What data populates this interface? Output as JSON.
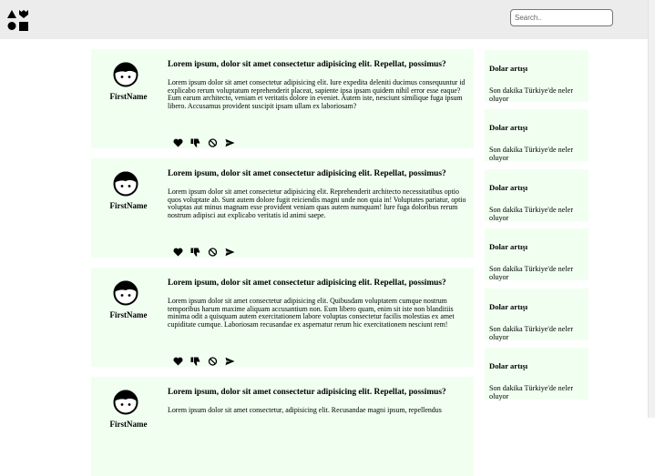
{
  "header": {
    "logo_icon": "shapes-logo-icon",
    "search": {
      "placeholder": "Search..",
      "value": ""
    }
  },
  "posts": [
    {
      "author": "FirstName",
      "avatar_icon": "person-avatar-icon",
      "title": "Lorem ipsum, dolor sit amet consectetur adipisicing elit. Repellat, possimus?",
      "body": "Lorem ipsum dolor sit amet consectetur adipisicing elit. Iure expedita deleniti ducimus consequuntur id explicabo rerum voluptatum reprehenderit placeat, sapiente ipsa ipsam quidem nihil error esse eaque? Eum earum architecto, veniam et veritatis dolore in eveniet. Autem iste, nesciunt similique fuga ipsum libero. Accusamus provident suscipit ipsam ullam ex laboriosam?"
    },
    {
      "author": "FirstName",
      "avatar_icon": "person-avatar-icon",
      "title": "Lorem ipsum, dolor sit amet consectetur adipisicing elit. Repellat, possimus?",
      "body": "Lorem ipsum dolor sit amet consectetur adipisicing elit. Reprehenderit architecto necessitatibus optio quos voluptate ab. Sunt autem dolore fugit reiciendis magni unde non quia in! Voluptates pariatur, optio voluptas aut minus magnam esse provident veniam quas autem numquam! Iure fuga doloribus rerum nostrum adipisci aut explicabo veritatis id animi saepe."
    },
    {
      "author": "FirstName",
      "avatar_icon": "person-avatar-icon",
      "title": "Lorem ipsum, dolor sit amet consectetur adipisicing elit. Repellat, possimus?",
      "body": "Lorem ipsum dolor sit amet consectetur adipisicing elit. Quibusdam voluptatem cumque nostrum temporibus harum maxime aliquam accusantium non. Eum libero quam, enim sit iste non blanditiis minima odit a quisquam autem exercitationem labore voluptas consectetur facilis molestias ex amet cupiditate cumque. Laboriosam recusandae ex aspernatur rerum hic exercitationem nesciunt rem!"
    },
    {
      "author": "FirstName",
      "avatar_icon": "person-avatar-icon",
      "title": "Lorem ipsum, dolor sit amet consectetur adipisicing elit. Repellat, possimus?",
      "body": "Lorem ipsum dolor sit amet consectetur, adipisicing elit. Recusandae magni ipsum, repellendus"
    }
  ],
  "post_actions": [
    {
      "icon": "heart-icon"
    },
    {
      "icon": "thumbs-down-icon"
    },
    {
      "icon": "block-icon"
    },
    {
      "icon": "send-icon"
    }
  ],
  "sidebar": {
    "cards": [
      {
        "title": "Dolar artışı",
        "text": "Son dakika Türkiye'de neler oluyor"
      },
      {
        "title": "Dolar artışı",
        "text": "Son dakika Türkiye'de neler oluyor"
      },
      {
        "title": "Dolar artışı",
        "text": "Son dakika Türkiye'de neler oluyor"
      },
      {
        "title": "Dolar artışı",
        "text": "Son dakika Türkiye'de neler oluyor"
      },
      {
        "title": "Dolar artışı",
        "text": "Son dakika Türkiye'de neler oluyor"
      },
      {
        "title": "Dolar artışı",
        "text": "Son dakika Türkiye'de neler oluyor"
      }
    ]
  },
  "colors": {
    "header_bg": "#ececec",
    "card_bg": "#f1fff1",
    "page_bg": "#ffffff"
  }
}
